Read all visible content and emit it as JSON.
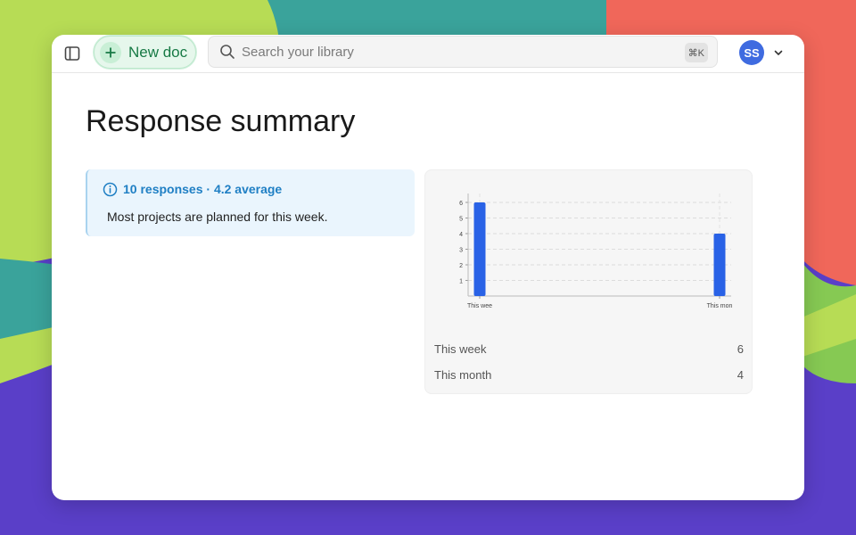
{
  "colors": {
    "accent_green": "#177a45",
    "info_blue": "#1f7fc4",
    "bar_blue": "#2962e6",
    "avatar_blue": "#3f6be0"
  },
  "toolbar": {
    "sidebar_icon": "sidebar-panel-icon",
    "new_doc_label": "New doc",
    "new_doc_icon": "plus-icon",
    "search_placeholder": "Search your library",
    "search_shortcut": "⌘K",
    "avatar_initials": "SS"
  },
  "main": {
    "title": "Response summary",
    "callout": {
      "icon": "info-icon",
      "heading": "10 responses · 4.2 average",
      "body": "Most projects are planned for this week."
    },
    "summary": [
      {
        "label": "This week",
        "value": "6"
      },
      {
        "label": "This month",
        "value": "4"
      }
    ]
  },
  "chart_data": {
    "type": "bar",
    "categories": [
      "This wee",
      "This mon"
    ],
    "values": [
      6,
      4
    ],
    "yticks": [
      1,
      2,
      3,
      4,
      5,
      6
    ],
    "ylim": [
      0,
      6
    ],
    "grid": true
  }
}
